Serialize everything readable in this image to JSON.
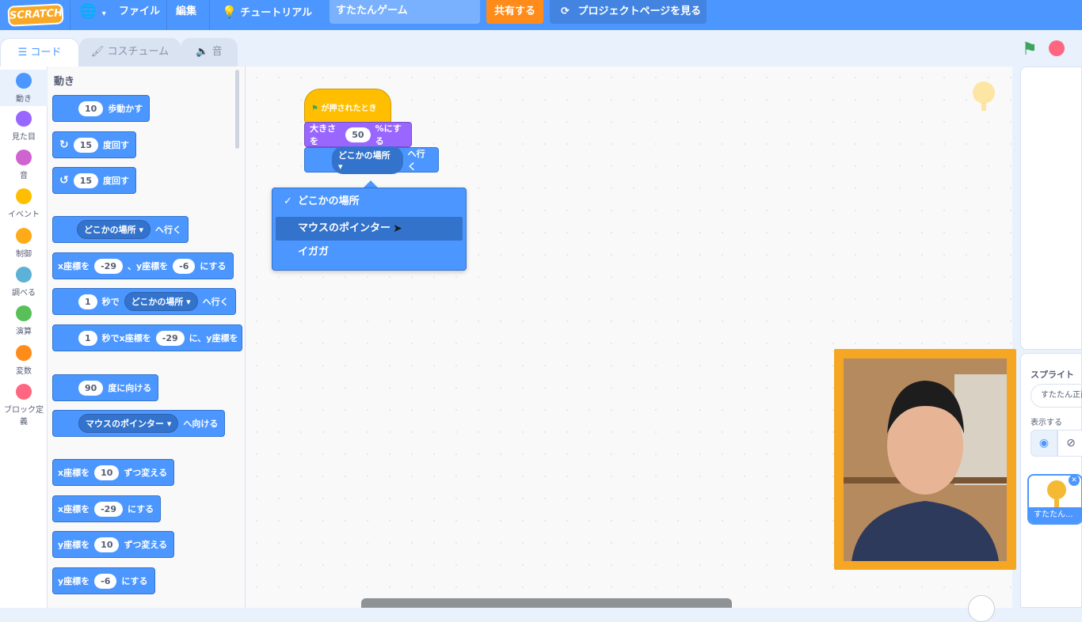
{
  "menubar": {
    "logo_text": "SCRATCH",
    "file": "ファイル",
    "edit": "編集",
    "tutorial": "チュートリアル",
    "project_title": "すたたんゲーム",
    "share": "共有する",
    "project_page": "プロジェクトページを見る"
  },
  "tabs": {
    "code": "コード",
    "costumes": "コスチューム",
    "sounds": "音"
  },
  "categories": [
    {
      "label": "動き",
      "color": "#4c97ff"
    },
    {
      "label": "見た目",
      "color": "#9966ff"
    },
    {
      "label": "音",
      "color": "#cf63cf"
    },
    {
      "label": "イベント",
      "color": "#ffbf00"
    },
    {
      "label": "制御",
      "color": "#ffab19"
    },
    {
      "label": "調べる",
      "color": "#5cb1d6"
    },
    {
      "label": "演算",
      "color": "#59c059"
    },
    {
      "label": "変数",
      "color": "#ff8c1a"
    },
    {
      "label": "ブロック定義",
      "color": "#ff6680"
    }
  ],
  "palette": {
    "heading": "動き",
    "move": {
      "value": "10",
      "text": "歩動かす"
    },
    "turn_right": {
      "value": "15",
      "text": "度回す"
    },
    "turn_left": {
      "value": "15",
      "text": "度回す"
    },
    "goto": {
      "dropdown": "どこかの場所",
      "text": "へ行く"
    },
    "goto_xy": {
      "x_label": "x座標を",
      "x": "-29",
      "y_label": "、y座標を",
      "y": "-6",
      "text": "にする"
    },
    "glide": {
      "secs": "1",
      "mid": "秒で",
      "dropdown": "どこかの場所",
      "text": "へ行く"
    },
    "glide_xy": {
      "secs": "1",
      "mid": "秒でx座標を",
      "x": "-29",
      "y_label": "に、y座標を"
    },
    "point_dir": {
      "value": "90",
      "text": "度に向ける"
    },
    "point_towards": {
      "dropdown": "マウスのポインター",
      "text": "へ向ける"
    },
    "change_x": {
      "label": "x座標を",
      "value": "10",
      "text": "ずつ変える"
    },
    "set_x": {
      "label": "x座標を",
      "value": "-29",
      "text": "にする"
    },
    "change_y": {
      "label": "y座標を",
      "value": "10",
      "text": "ずつ変える"
    },
    "set_y": {
      "label": "y座標を",
      "value": "-6",
      "text": "にする"
    }
  },
  "script": {
    "hat": "が押されたとき",
    "size_label": "大きさを",
    "size_value": "50",
    "size_text": "%にする",
    "goto_dropdown": "どこかの場所",
    "goto_text": "へ行く"
  },
  "dropdown": {
    "items": [
      "どこかの場所",
      "マウスのポインター",
      "イガガ"
    ],
    "checked": "どこかの場所",
    "hovered": "マウスのポインター"
  },
  "sprite_pane": {
    "label": "スプライト",
    "name_value": "すたたん正面",
    "show_label": "表示する",
    "thumb_caption": "すたたん..."
  }
}
